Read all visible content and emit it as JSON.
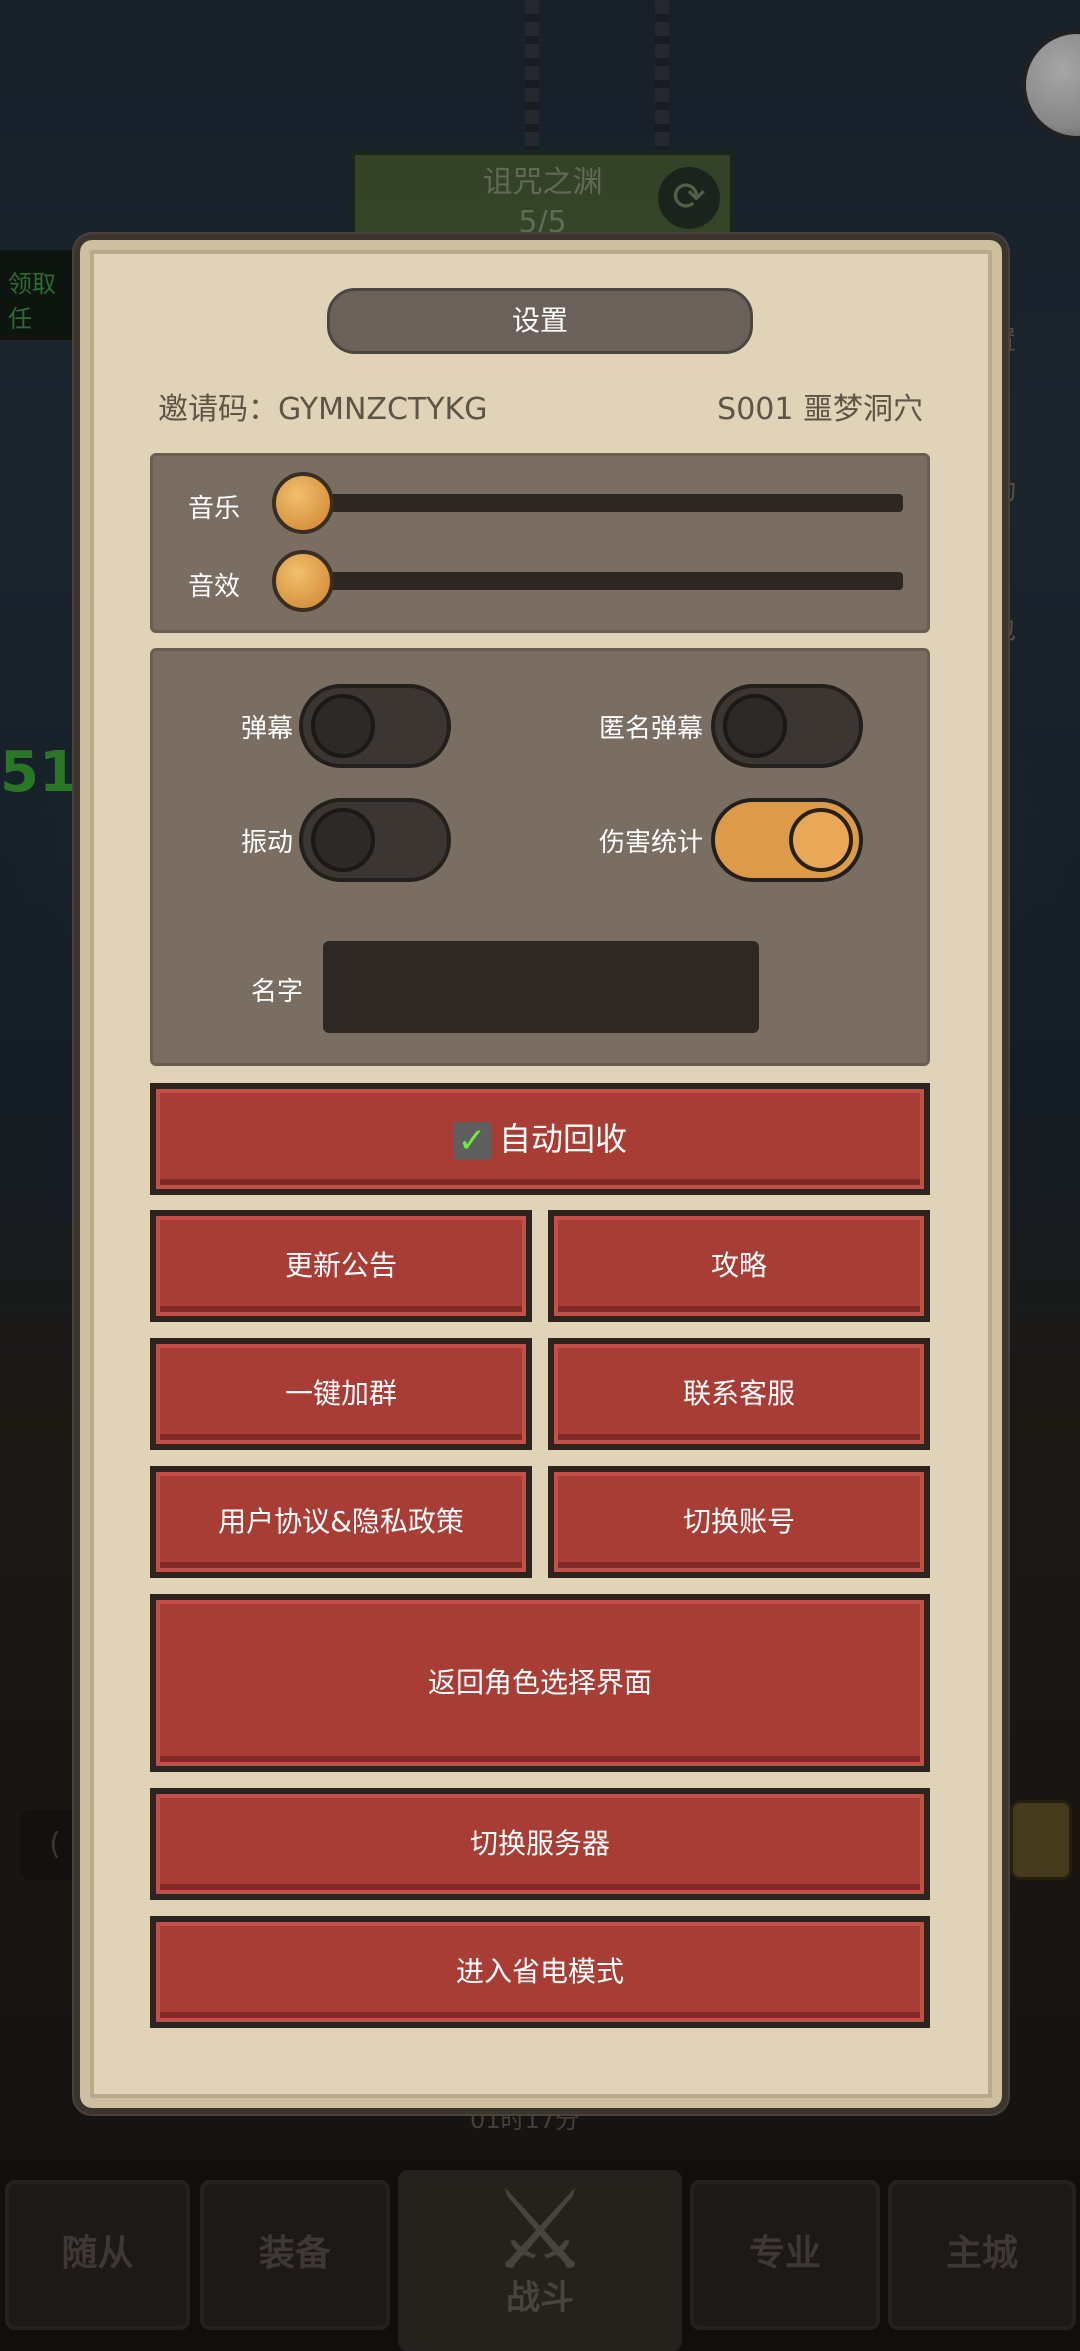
{
  "background": {
    "stage_title": "诅咒之渊",
    "stage_progress": "5/5",
    "left_task": "领取任",
    "left_number": "51",
    "side_labels": [
      "置",
      "动",
      "包"
    ],
    "time_text": "01时17分",
    "left_box_text": "(",
    "bottom_tabs": [
      "随从",
      "装备",
      "战斗",
      "专业",
      "主城"
    ]
  },
  "settings": {
    "title": "设置",
    "invite_label": "邀请码：GYMNZCTYKG",
    "server_label": "S001 噩梦洞穴",
    "sliders": [
      {
        "label": "音乐",
        "value": 0
      },
      {
        "label": "音效",
        "value": 0
      }
    ],
    "toggles": {
      "barrage": {
        "label": "弹幕",
        "on": false
      },
      "anon_barrage": {
        "label": "匿名弹幕",
        "on": false
      },
      "vibration": {
        "label": "振动",
        "on": false
      },
      "damage_stats": {
        "label": "伤害统计",
        "on": true
      }
    },
    "name_label": "名字",
    "buttons": {
      "auto_recycle": "自动回收",
      "update_notice": "更新公告",
      "guide": "攻略",
      "join_group": "一键加群",
      "contact_service": "联系客服",
      "agreement": "用户协议&隐私政策",
      "switch_account": "切换账号",
      "return_role_select": "返回角色选择界面",
      "switch_server": "切换服务器",
      "power_save": "进入省电模式"
    },
    "auto_recycle_checked": true
  },
  "colors": {
    "panel_bg": "#e0d3b8",
    "button_red": "#a83d36",
    "toggle_on": "#dc9b48",
    "check_green": "#72e842"
  }
}
